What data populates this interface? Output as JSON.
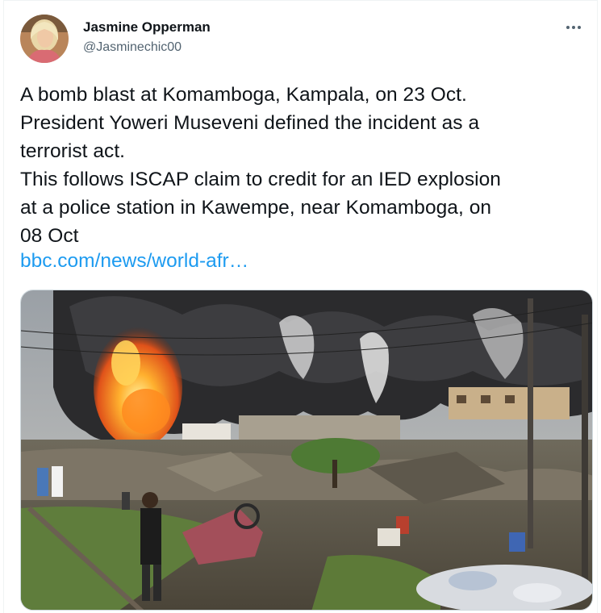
{
  "author": {
    "display_name": "Jasmine Opperman",
    "handle": "@Jasminechic00"
  },
  "icons": {
    "more": "more-horizontal-icon"
  },
  "tweet": {
    "lines": [
      "A bomb blast at Komamboga, Kampala, on 23 Oct.",
      "President Yoweri Museveni defined the incident as a",
      "terrorist act.",
      "This follows ISCAP claim to credit for an IED explosion",
      "at a police station in Kawempe, near Komamboga, on",
      "08 Oct"
    ],
    "link_text": "bbc.com/news/world-afr…"
  },
  "colors": {
    "link": "#1d9bf0",
    "secondary_text": "#536471",
    "primary_text": "#0f1419"
  }
}
